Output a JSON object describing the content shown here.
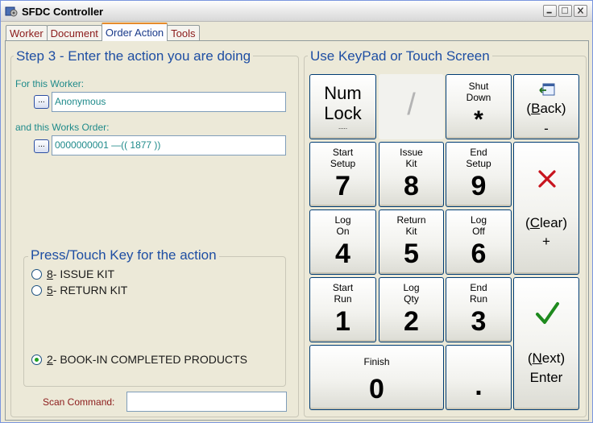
{
  "window": {
    "title": "SFDC Controller"
  },
  "tabs": [
    {
      "label": "Worker"
    },
    {
      "label": "Document"
    },
    {
      "label": "Order Action"
    },
    {
      "label": "Tools"
    }
  ],
  "step": {
    "title": "Step 3 - Enter the action you are doing",
    "worker_label": "For this Worker:",
    "worker_value": "Anonymous",
    "order_label": "and this Works Order:",
    "order_value": "0000000001    —(( 1877 ))",
    "browse_label": "..."
  },
  "actions": {
    "title": "Press/Touch Key for the action",
    "options": [
      {
        "key": "8",
        "text": " - ISSUE KIT",
        "selected": false
      },
      {
        "key": "5",
        "text": " - RETURN KIT",
        "selected": false
      },
      {
        "key": "2",
        "text": " - BOOK-IN COMPLETED PRODUCTS",
        "selected": true
      }
    ]
  },
  "scan": {
    "label": "Scan Command:",
    "value": ""
  },
  "keypad": {
    "title": "Use KeyPad or Touch Screen",
    "numlock": {
      "line1": "Num",
      "line2": "Lock",
      "sub": "....."
    },
    "slash": "/",
    "shutdown": {
      "line1": "Shut",
      "line2": "Down",
      "key": "*"
    },
    "back": {
      "pre": "(",
      "accel": "B",
      "rest": "ack)",
      "key": "-"
    },
    "clear": {
      "pre": "(",
      "accel": "C",
      "rest": "lear)",
      "key": "+"
    },
    "next": {
      "pre": "(",
      "accel": "N",
      "rest": "ext)",
      "key": "Enter"
    },
    "keys": [
      {
        "line1": "Start",
        "line2": "Setup",
        "digit": "7"
      },
      {
        "line1": "Issue",
        "line2": "Kit",
        "digit": "8"
      },
      {
        "line1": "End",
        "line2": "Setup",
        "digit": "9"
      },
      {
        "line1": "Log",
        "line2": "On",
        "digit": "4"
      },
      {
        "line1": "Return",
        "line2": "Kit",
        "digit": "5"
      },
      {
        "line1": "Log",
        "line2": "Off",
        "digit": "6"
      },
      {
        "line1": "Start",
        "line2": "Run",
        "digit": "1"
      },
      {
        "line1": "Log",
        "line2": "Qty",
        "digit": "2"
      },
      {
        "line1": "End",
        "line2": "Run",
        "digit": "3"
      }
    ],
    "zero": {
      "line1": "Finish",
      "digit": "0"
    },
    "dot": "."
  }
}
